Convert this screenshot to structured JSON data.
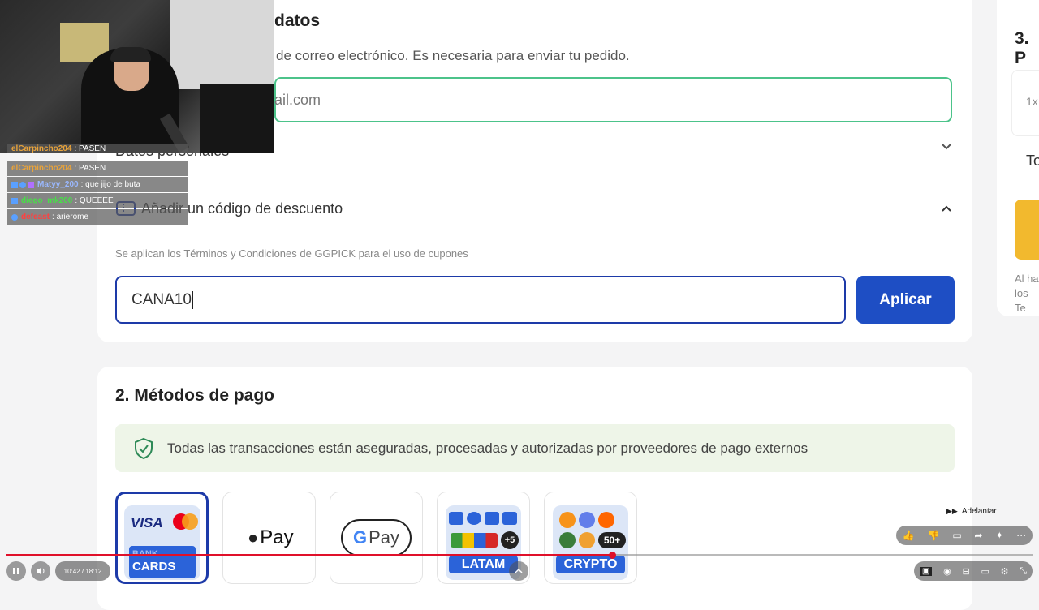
{
  "contact": {
    "title_fragment": "datos",
    "desc_fragment": "de correo electrónico. Es necesaria para enviar tu pedido.",
    "email_value_fragment": "ail.com"
  },
  "personal": {
    "title_fragment": "Datos personales"
  },
  "discount": {
    "title": "Añadir un código de descuento",
    "terms": "Se aplican los Términos y Condiciones de GGPICK para el uso de cupones",
    "code_value": "CANA10",
    "apply_label": "Aplicar"
  },
  "payment": {
    "title": "2. Métodos de pago",
    "secure_note": "Todas las transacciones están aseguradas, procesadas y autorizadas por proveedores de pago externos",
    "methods": [
      {
        "top": "BANK",
        "bottom": "CARDS",
        "brand": "VISA"
      },
      {
        "label": "Pay"
      },
      {
        "label": "Pay"
      },
      {
        "badge": "+5",
        "bottom": "LATAM"
      },
      {
        "badge": "50+",
        "bottom": "CRYPTO"
      }
    ]
  },
  "summary": {
    "title_fragment": "3. P",
    "qty_fragment": "1x",
    "total_fragment": "To",
    "note_line1": "Al ha",
    "note_line2": "los Te"
  },
  "chat": [
    {
      "user": "elCarpincho204",
      "msg": ": PASEN",
      "color": "#e8a33b"
    },
    {
      "user": "elCarpincho204",
      "msg": ": PASEN",
      "color": "#e8a33b"
    },
    {
      "user": "Matyy_200",
      "msg": ": que jijo de buta",
      "color": "#9ab8ff"
    },
    {
      "user": "diego_mk200",
      "msg": ": QUEEEE",
      "color": "#48e048"
    },
    {
      "user": "defeast",
      "msg": ": arierome",
      "color": "#ff4040"
    }
  ],
  "player": {
    "time": "10:42 / 18:12",
    "forward_label": "Adelantar",
    "progress": 0.59
  },
  "colors": {
    "accent_blue": "#1e4ec4",
    "email_border": "#4cc38a",
    "progress_red": "#e0102a"
  }
}
